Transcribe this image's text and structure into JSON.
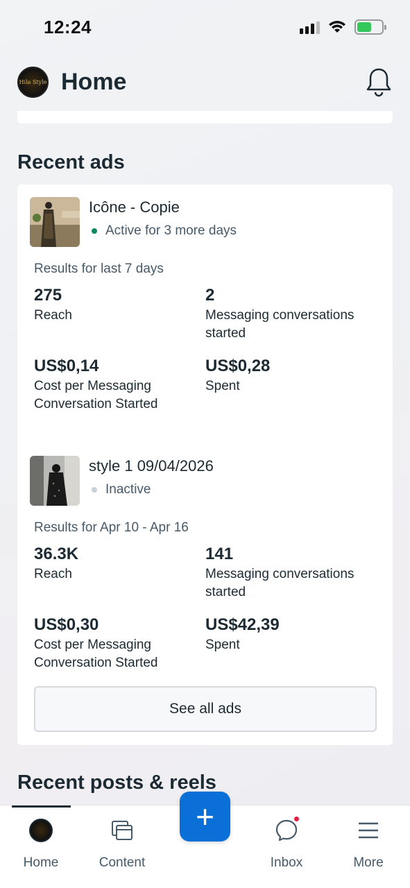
{
  "status_bar": {
    "time": "12:24"
  },
  "header": {
    "title": "Home",
    "avatar_text": "Hila Style"
  },
  "recent_ads": {
    "title": "Recent ads",
    "ads": [
      {
        "name": "Icône - Copie",
        "status": "Active for 3 more days",
        "status_color": "#0a8a5c",
        "results_label": "Results for last 7 days",
        "metrics": [
          {
            "value": "275",
            "label": "Reach"
          },
          {
            "value": "2",
            "label": "Messaging conversations started"
          },
          {
            "value": "US$0,14",
            "label": "Cost per Messaging Conversation Started"
          },
          {
            "value": "US$0,28",
            "label": "Spent"
          }
        ]
      },
      {
        "name": "style 1 09/04/2026",
        "status": "Inactive",
        "status_color": "#c9d0d6",
        "results_label": "Results for Apr 10 - Apr 16",
        "metrics": [
          {
            "value": "36.3K",
            "label": "Reach"
          },
          {
            "value": "141",
            "label": "Messaging conversations started"
          },
          {
            "value": "US$0,30",
            "label": "Cost per Messaging Conversation Started"
          },
          {
            "value": "US$42,39",
            "label": "Spent"
          }
        ]
      }
    ],
    "see_all_label": "See all ads"
  },
  "recent_posts": {
    "title": "Recent posts & reels"
  },
  "bottom_nav": {
    "items": [
      {
        "label": "Home",
        "icon": "home-avatar-icon"
      },
      {
        "label": "Content",
        "icon": "content-icon"
      },
      {
        "label": "Inbox",
        "icon": "inbox-icon"
      },
      {
        "label": "More",
        "icon": "menu-icon"
      }
    ],
    "fab_label": "+"
  },
  "colors": {
    "accent": "#0a6fd6",
    "text": "#1c2b33",
    "notification": "#e41e3f"
  }
}
